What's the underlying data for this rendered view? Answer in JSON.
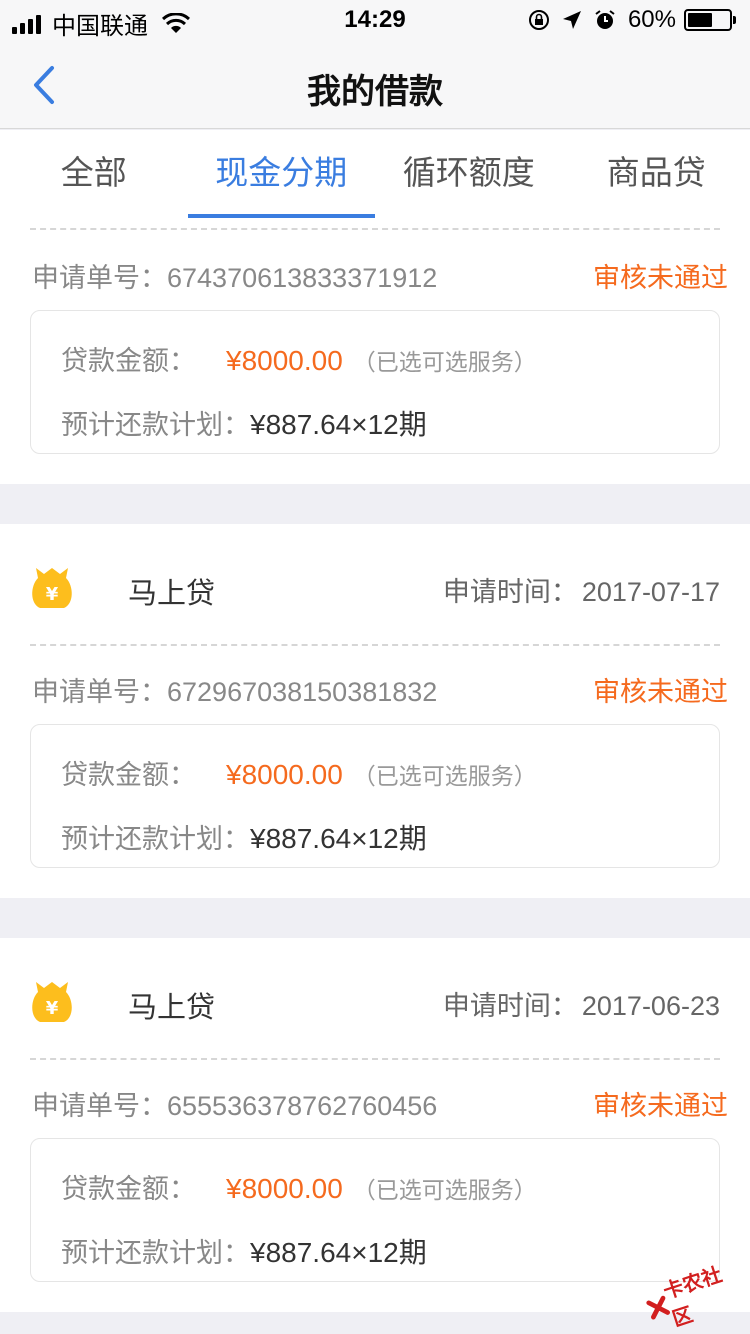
{
  "status_bar": {
    "carrier": "中国联通",
    "time": "14:29",
    "battery": "60%",
    "battery_level": 0.6
  },
  "nav": {
    "title": "我的借款",
    "back_icon": "chevron-left-icon"
  },
  "tabs": [
    {
      "label": "全部",
      "active": false
    },
    {
      "label": "现金分期",
      "active": true
    },
    {
      "label": "循环额度",
      "active": false
    },
    {
      "label": "商品贷",
      "active": false
    }
  ],
  "colors": {
    "accent": "#3a7de0",
    "status": "#f56a1e",
    "icon": "#fdbe1d"
  },
  "loans": [
    {
      "product": "",
      "time_label": "",
      "time": "",
      "order_label": "申请单号：",
      "order_no": "674370613833371912",
      "status": "审核未通过",
      "amount_label": "贷款金额：",
      "amount": "¥8000.00",
      "service_note": "（已选可选服务）",
      "plan_label": "预计还款计划：",
      "plan": "¥887.64×12期"
    },
    {
      "product": "马上贷",
      "time_label": "申请时间：",
      "time": "2017-07-17",
      "order_label": "申请单号：",
      "order_no": "672967038150381832",
      "status": "审核未通过",
      "amount_label": "贷款金额：",
      "amount": "¥8000.00",
      "service_note": "（已选可选服务）",
      "plan_label": "预计还款计划：",
      "plan": "¥887.64×12期"
    },
    {
      "product": "马上贷",
      "time_label": "申请时间：",
      "time": "2017-06-23",
      "order_label": "申请单号：",
      "order_no": "655536378762760456",
      "status": "审核未通过",
      "amount_label": "贷款金额：",
      "amount": "¥8000.00",
      "service_note": "（已选可选服务）",
      "plan_label": "预计还款计划：",
      "plan": "¥887.64×12期"
    }
  ],
  "watermark": "卡农社区"
}
